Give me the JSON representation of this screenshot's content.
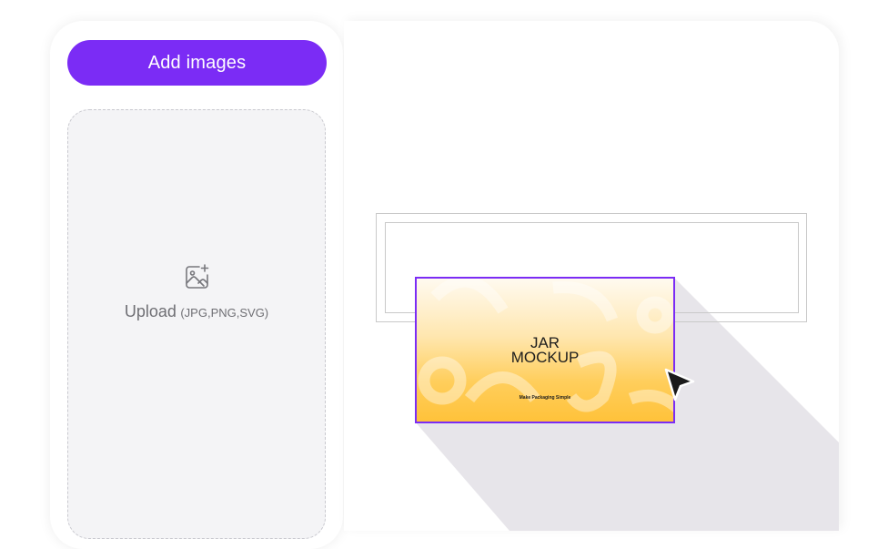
{
  "sidebar": {
    "add_button_label": "Add images",
    "upload": {
      "label": "Upload",
      "formats": "(JPG,PNG,SVG)",
      "icon": "image-add-icon"
    }
  },
  "canvas": {
    "dragged_image": {
      "title": "JAR\nMOCKUP",
      "subtitle": "Make Packaging Simple"
    },
    "cursor_icon": "pointer-arrow-icon"
  },
  "colors": {
    "accent": "#7b2cf5",
    "dropzone_bg": "#f4f4f6",
    "image_gradient_top": "#fffaf0",
    "image_gradient_bottom": "#ffc23a"
  }
}
